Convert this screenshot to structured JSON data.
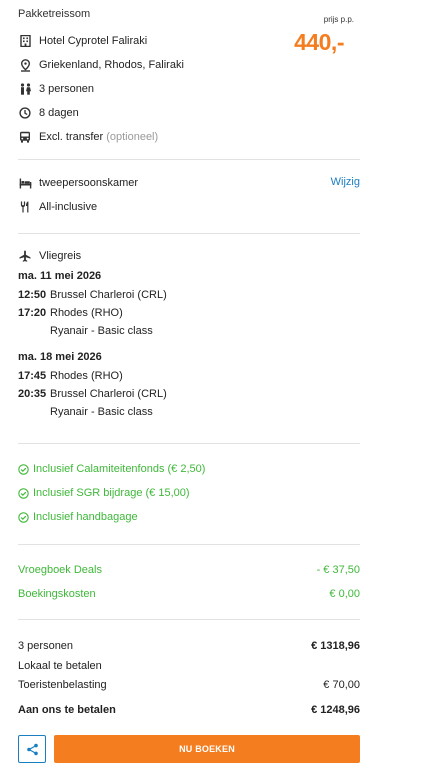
{
  "header": {
    "title": "Pakketreissom",
    "price_label": "prijs p.p.",
    "price": "440,-"
  },
  "details": [
    {
      "icon": "building-icon",
      "text": "Hotel Cyprotel Faliraki"
    },
    {
      "icon": "location-pin-icon",
      "text": "Griekenland, Rhodos, Faliraki"
    },
    {
      "icon": "people-icon",
      "text": "3 personen"
    },
    {
      "icon": "clock-icon",
      "text": "8 dagen"
    },
    {
      "icon": "bus-icon",
      "text": "Excl. transfer",
      "muted": "(optioneel)"
    }
  ],
  "room": {
    "room_type": "tweepersoonskamer",
    "change_link": "Wijzig",
    "board": "All-inclusive"
  },
  "flight": {
    "title": "Vliegreis",
    "outbound": {
      "date": "ma. 11 mei 2026",
      "dep_time": "12:50",
      "dep_airport": "Brussel Charleroi (CRL)",
      "arr_time": "17:20",
      "arr_airport": "Rhodes (RHO)",
      "carrier": "Ryanair - Basic class"
    },
    "return": {
      "date": "ma. 18 mei 2026",
      "dep_time": "17:45",
      "dep_airport": "Rhodes (RHO)",
      "arr_time": "20:35",
      "arr_airport": "Brussel Charleroi (CRL)",
      "carrier": "Ryanair - Basic class"
    }
  },
  "inclusions": [
    "Inclusief Calamiteitenfonds (€ 2,50)",
    "Inclusief SGR bijdrage (€ 15,00)",
    "Inclusief handbagage"
  ],
  "discounts": [
    {
      "label": "Vroegboek Deals",
      "value": "- € 37,50"
    },
    {
      "label": "Boekingskosten",
      "value": "€ 0,00"
    }
  ],
  "totals": {
    "persons_label": "3 personen",
    "persons_value": "€ 1318,96",
    "local_label": "Lokaal te betalen",
    "tax_label": "Toeristenbelasting",
    "tax_value": "€ 70,00",
    "pay_label": "Aan ons te betalen",
    "pay_value": "€ 1248,96"
  },
  "actions": {
    "book_label": "NU BOEKEN"
  },
  "colors": {
    "accent_orange": "#f47d1f",
    "link_blue": "#1a7fc1",
    "success_green": "#3fb83a"
  }
}
